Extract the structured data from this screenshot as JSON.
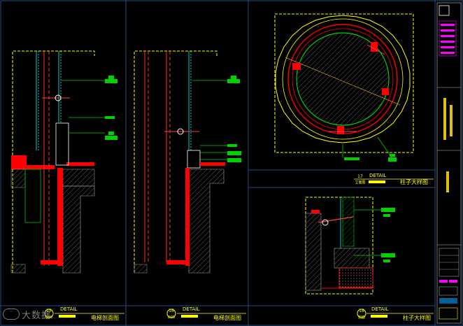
{
  "panels": [
    {
      "detail_word": "DETAIL",
      "title": "电梯剖面图",
      "num": "15",
      "sheet": "D08"
    },
    {
      "detail_word": "DETAIL",
      "title": "电梯剖面图",
      "num": "16",
      "sheet": "D08"
    },
    {
      "detail_word": "DETAIL",
      "title": "柱子大样图",
      "num": "17",
      "sheet": "立面图"
    },
    {
      "detail_word": "DETAIL",
      "title": "柱子大样图",
      "num": "18",
      "sheet": "剖面"
    }
  ],
  "watermark": "大数据",
  "colors": {
    "background": "#000000",
    "frame": "#2a4a7a",
    "wall": "#ffff00",
    "cut": "#ff0000",
    "hatch": "#8a8a8a",
    "green": "#00d000",
    "cyan": "#00c8c8",
    "label": "#00ff00",
    "magenta": "#ff00ff"
  }
}
